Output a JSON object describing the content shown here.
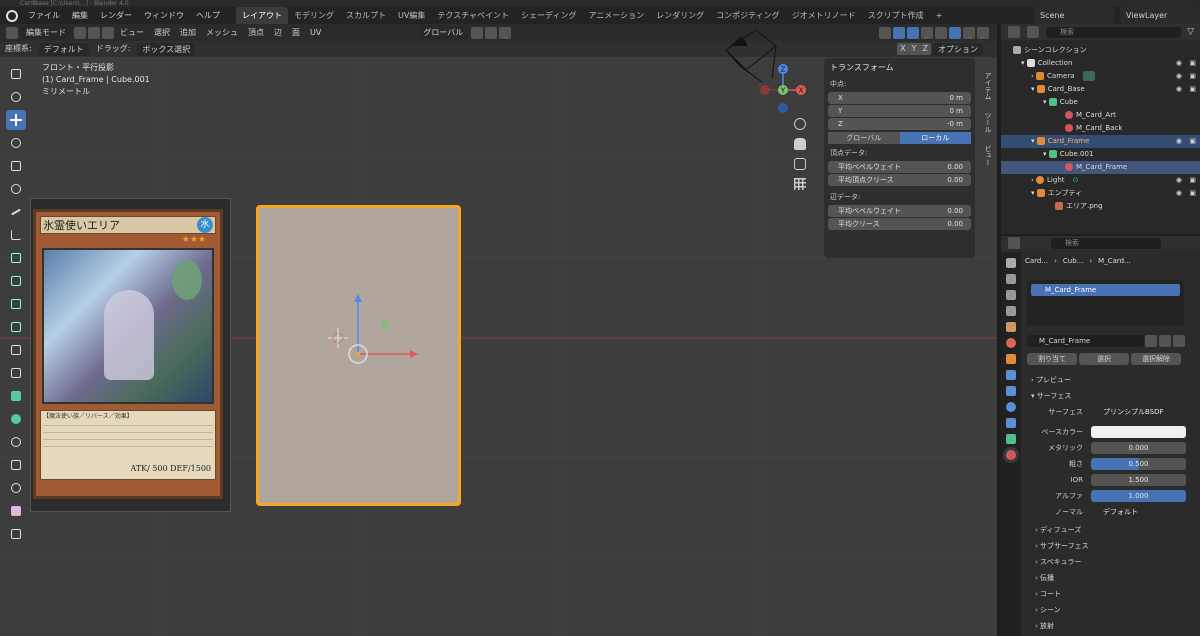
{
  "title_bar": "CardBase [C:\\Users\\...] - Blender 4.0",
  "menu": {
    "items": [
      "ファイル",
      "編集",
      "レンダー",
      "ウィンドウ",
      "ヘルプ"
    ],
    "workspaces": [
      "レイアウト",
      "モデリング",
      "スカルプト",
      "UV編集",
      "テクスチャペイント",
      "シェーディング",
      "アニメーション",
      "レンダリング",
      "コンポジティング",
      "ジオメトリノード",
      "スクリプト作成"
    ],
    "active_workspace": "レイアウト",
    "scene": "Scene",
    "view_layer": "ViewLayer"
  },
  "viewport": {
    "header": {
      "mode": "編集モード",
      "menus": [
        "ビュー",
        "選択",
        "追加",
        "メッシュ",
        "頂点",
        "辺",
        "面",
        "UV"
      ],
      "orientation": "グローバル",
      "xyz": [
        "X",
        "Y",
        "Z"
      ],
      "options": "オプション"
    },
    "header2": {
      "coord_label": "座標系:",
      "coord_value": "デフォルト",
      "drag_label": "ドラッグ:",
      "drag_value": "ボックス選択"
    },
    "info": {
      "view": "フロント・平行投影",
      "object": "(1) Card_Frame | Cube.001",
      "units": "ミリメートル"
    },
    "gizmo": {
      "x": "X",
      "y": "Y",
      "z": "Z"
    },
    "card": {
      "name": "氷霊使いエリア",
      "attribute": "水",
      "stars": 3,
      "effect_text": "【魔法使い族／リバース／効果】",
      "atk_def": "ATK/  500  DEF/1500"
    }
  },
  "npanel": {
    "title": "トランスフォーム",
    "median_label": "中点:",
    "fields": [
      {
        "label": "X",
        "value": "0 m"
      },
      {
        "label": "Y",
        "value": "0 m"
      },
      {
        "label": "Z",
        "value": "-0 m"
      }
    ],
    "toggle": [
      "グローバル",
      "ローカル"
    ],
    "vertex_label": "頂点データ:",
    "vertex_fields": [
      {
        "label": "平均ベベルウェイト",
        "value": "0.00"
      },
      {
        "label": "平均頂点クリース",
        "value": "0.00"
      }
    ],
    "edge_label": "辺データ:",
    "edge_fields": [
      {
        "label": "平均ベベルウェイト",
        "value": "0.00"
      },
      {
        "label": "平均クリース",
        "value": "0.00"
      }
    ],
    "tabs": [
      "アイテム",
      "ツール",
      "ビュー"
    ]
  },
  "outliner": {
    "search_placeholder": "検索",
    "rows": [
      {
        "label": "シーンコレクション",
        "indent": 0
      },
      {
        "label": "Collection",
        "indent": 1
      },
      {
        "label": "Camera",
        "indent": 2
      },
      {
        "label": "Card_Base",
        "indent": 2
      },
      {
        "label": "Cube",
        "indent": 3
      },
      {
        "label": "M_Card_Art",
        "indent": 4
      },
      {
        "label": "M_Card_Back",
        "indent": 4
      },
      {
        "label": "Card_Frame",
        "indent": 2
      },
      {
        "label": "Cube.001",
        "indent": 3
      },
      {
        "label": "M_Card_Frame",
        "indent": 4
      },
      {
        "label": "Light",
        "indent": 2
      },
      {
        "label": "エンプティ",
        "indent": 2
      },
      {
        "label": "エリア.png",
        "indent": 3
      }
    ]
  },
  "properties": {
    "search_placeholder": "検索",
    "breadcrumb": [
      "Card...",
      "Cub...",
      "M_Card..."
    ],
    "slot": "M_Card_Frame",
    "material_name": "M_Card_Frame",
    "buttons": [
      "割り当て",
      "選択",
      "選択解除"
    ],
    "preview": "プレビュー",
    "surface_section": "サーフェス",
    "surface_label": "サーフェス",
    "surface_value": "プリンシプルBSDF",
    "base_color_label": "ベースカラー",
    "params": [
      {
        "label": "メタリック",
        "value": "0.000"
      },
      {
        "label": "粗さ",
        "value": "0.500"
      },
      {
        "label": "IOR",
        "value": "1.500"
      },
      {
        "label": "アルファ",
        "value": "1.000"
      }
    ],
    "normal_label": "ノーマル",
    "normal_value": "デフォルト",
    "subsections": [
      "ディフューズ",
      "サブサーフェス",
      "スペキュラー",
      "伝播",
      "コート",
      "シーン",
      "放射"
    ]
  },
  "colors": {
    "accent": "#4772b3",
    "selection_outline": "#f5a623",
    "viewport_bg": "#3d3d3d",
    "plane_fill": "#b0a69d"
  }
}
